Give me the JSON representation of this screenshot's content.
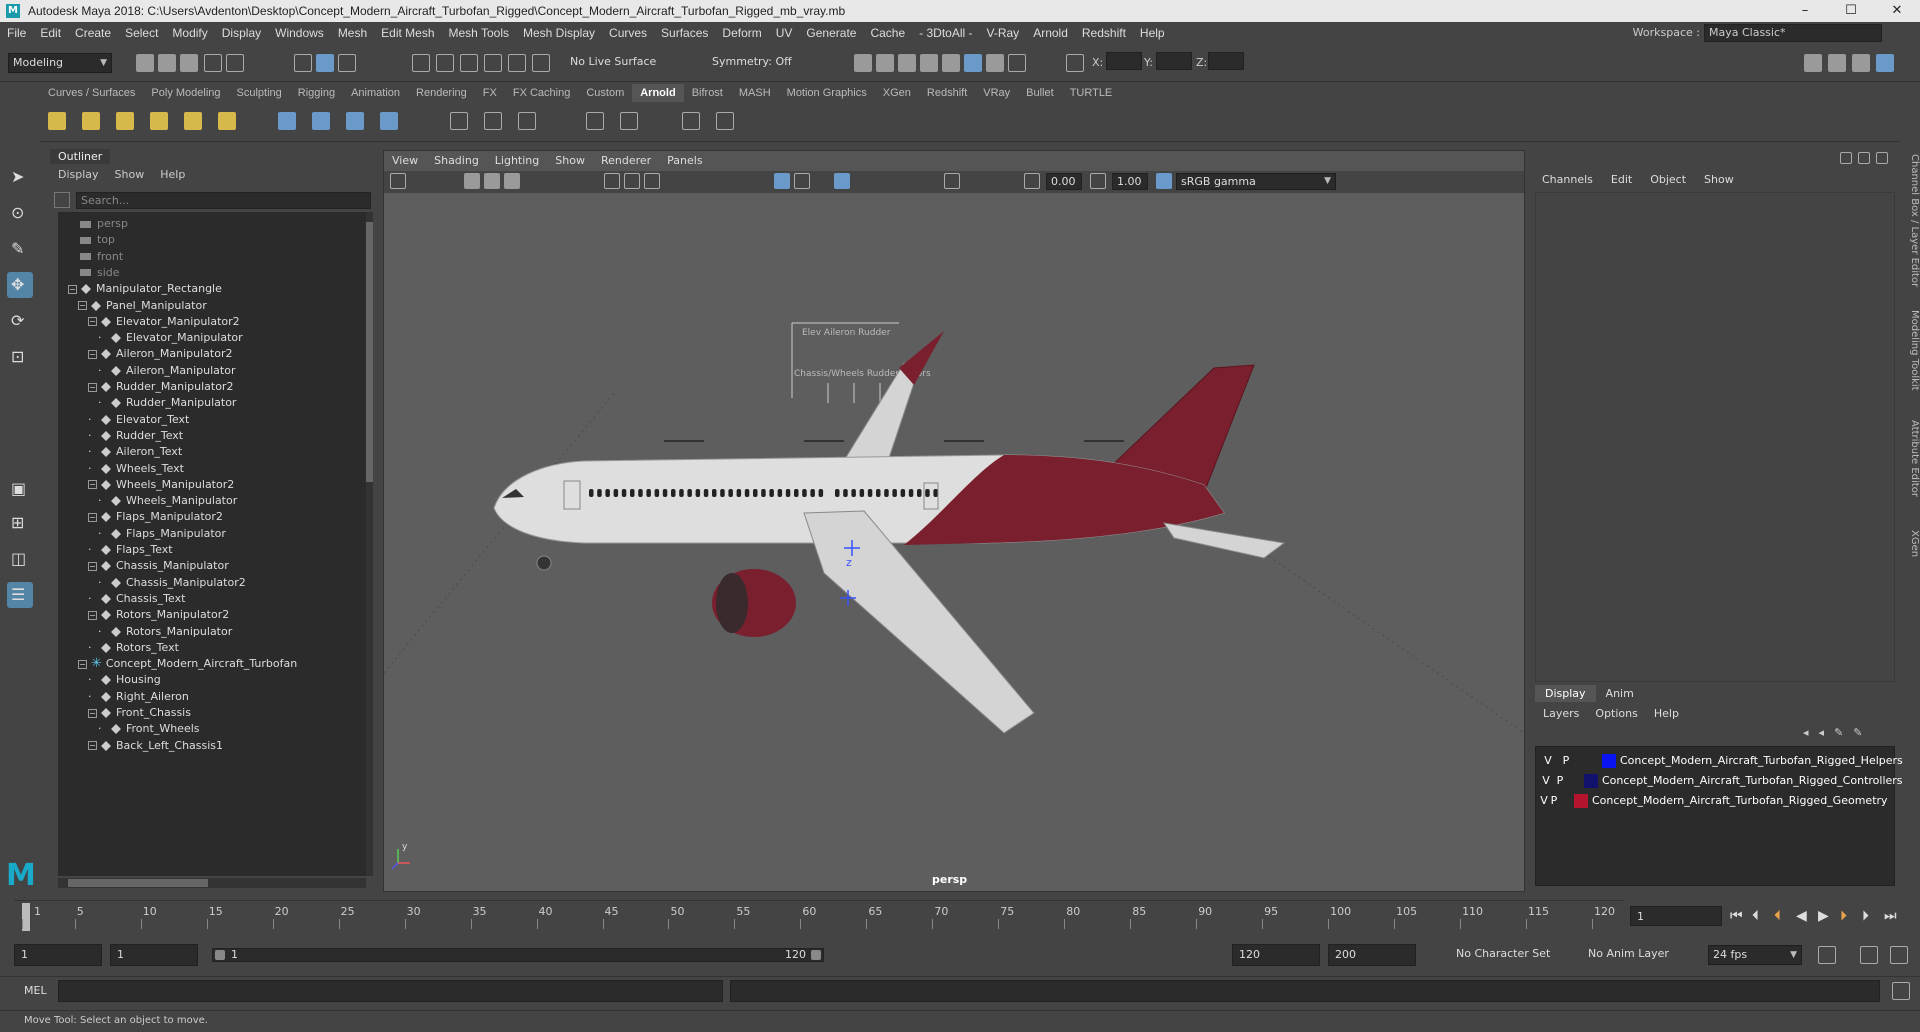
{
  "titlebar": {
    "title": "Autodesk Maya 2018: C:\\Users\\Avdenton\\Desktop\\Concept_Modern_Aircraft_Turbofan_Rigged\\Concept_Modern_Aircraft_Turbofan_Rigged_mb_vray.mb",
    "minimize": "–",
    "maximize": "☐",
    "close": "✕"
  },
  "menubar": {
    "items": [
      "File",
      "Edit",
      "Create",
      "Select",
      "Modify",
      "Display",
      "Windows",
      "Mesh",
      "Edit Mesh",
      "Mesh Tools",
      "Mesh Display",
      "Curves",
      "Surfaces",
      "Deform",
      "UV",
      "Generate",
      "Cache",
      "- 3DtoAll -",
      "V-Ray",
      "Arnold",
      "Redshift",
      "Help"
    ],
    "workspace_label": "Workspace :",
    "workspace_value": "Maya Classic*"
  },
  "statusline": {
    "mode": "Modeling",
    "live_surface": "No Live Surface",
    "symmetry": "Symmetry: Off",
    "x_label": "X:",
    "y_label": "Y:",
    "z_label": "Z:"
  },
  "shelf": {
    "tabs": [
      "Curves / Surfaces",
      "Poly Modeling",
      "Sculpting",
      "Rigging",
      "Animation",
      "Rendering",
      "FX",
      "FX Caching",
      "Custom",
      "Arnold",
      "Bifrost",
      "MASH",
      "Motion Graphics",
      "XGen",
      "Redshift",
      "VRay",
      "Bullet",
      "TURTLE"
    ],
    "active_tab": "Arnold"
  },
  "outliner": {
    "title": "Outliner",
    "menu": [
      "Display",
      "Show",
      "Help"
    ],
    "search_placeholder": "Search...",
    "nodes": [
      {
        "label": "persp",
        "indent": 0,
        "type": "camera"
      },
      {
        "label": "top",
        "indent": 0,
        "type": "camera"
      },
      {
        "label": "front",
        "indent": 0,
        "type": "camera"
      },
      {
        "label": "side",
        "indent": 0,
        "type": "camera"
      },
      {
        "label": "Manipulator_Rectangle",
        "indent": 0,
        "type": "group",
        "expanded": true
      },
      {
        "label": "Panel_Manipulator",
        "indent": 1,
        "type": "group",
        "expanded": true
      },
      {
        "label": "Elevator_Manipulator2",
        "indent": 2,
        "type": "group",
        "expanded": true
      },
      {
        "label": "Elevator_Manipulator",
        "indent": 3,
        "type": "node"
      },
      {
        "label": "Aileron_Manipulator2",
        "indent": 2,
        "type": "group",
        "expanded": true
      },
      {
        "label": "Aileron_Manipulator",
        "indent": 3,
        "type": "node"
      },
      {
        "label": "Rudder_Manipulator2",
        "indent": 2,
        "type": "group",
        "expanded": true
      },
      {
        "label": "Rudder_Manipulator",
        "indent": 3,
        "type": "node"
      },
      {
        "label": "Elevator_Text",
        "indent": 2,
        "type": "node"
      },
      {
        "label": "Rudder_Text",
        "indent": 2,
        "type": "node"
      },
      {
        "label": "Aileron_Text",
        "indent": 2,
        "type": "node"
      },
      {
        "label": "Wheels_Text",
        "indent": 2,
        "type": "node"
      },
      {
        "label": "Wheels_Manipulator2",
        "indent": 2,
        "type": "group",
        "expanded": true
      },
      {
        "label": "Wheels_Manipulator",
        "indent": 3,
        "type": "node"
      },
      {
        "label": "Flaps_Manipulator2",
        "indent": 2,
        "type": "group",
        "expanded": true
      },
      {
        "label": "Flaps_Manipulator",
        "indent": 3,
        "type": "node"
      },
      {
        "label": "Flaps_Text",
        "indent": 2,
        "type": "node"
      },
      {
        "label": "Chassis_Manipulator",
        "indent": 2,
        "type": "group",
        "expanded": true
      },
      {
        "label": "Chassis_Manipulator2",
        "indent": 3,
        "type": "node"
      },
      {
        "label": "Chassis_Text",
        "indent": 2,
        "type": "node"
      },
      {
        "label": "Rotors_Manipulator2",
        "indent": 2,
        "type": "group",
        "expanded": true
      },
      {
        "label": "Rotors_Manipulator",
        "indent": 3,
        "type": "node"
      },
      {
        "label": "Rotors_Text",
        "indent": 2,
        "type": "node"
      },
      {
        "label": "Concept_Modern_Aircraft_Turbofan",
        "indent": 1,
        "type": "joint",
        "expanded": true
      },
      {
        "label": "Housing",
        "indent": 2,
        "type": "node"
      },
      {
        "label": "Right_Aileron",
        "indent": 2,
        "type": "node"
      },
      {
        "label": "Front_Chassis",
        "indent": 2,
        "type": "group",
        "expanded": true
      },
      {
        "label": "Front_Wheels",
        "indent": 3,
        "type": "node"
      },
      {
        "label": "Back_Left_Chassis1",
        "indent": 2,
        "type": "group",
        "expanded": true
      }
    ]
  },
  "viewport": {
    "menu": [
      "View",
      "Shading",
      "Lighting",
      "Show",
      "Renderer",
      "Panels"
    ],
    "exposure": "0.00",
    "gamma": "1.00",
    "colorspace": "sRGB gamma",
    "camera_label": "persp",
    "overlay_text_1": "Elev   Aileron  Rudder",
    "overlay_text_2": "Chassis/Wheels   Rudder   Rotors",
    "axis_y": "y",
    "axis_z": "z"
  },
  "channelbox": {
    "menu": [
      "Channels",
      "Edit",
      "Object",
      "Show"
    ],
    "side_tabs": [
      "Channel Box / Layer Editor",
      "Modeling Toolkit",
      "Attribute Editor",
      "XGen"
    ]
  },
  "layers": {
    "tabs": [
      "Display",
      "Anim"
    ],
    "menu": [
      "Layers",
      "Options",
      "Help"
    ],
    "items": [
      {
        "v": "V",
        "p": "P",
        "name": "Concept_Modern_Aircraft_Turbofan_Rigged_Helpers",
        "color": "#0a14f0"
      },
      {
        "v": "V",
        "p": "P",
        "name": "Concept_Modern_Aircraft_Turbofan_Rigged_Controllers",
        "color": "#12126e"
      },
      {
        "v": "V",
        "p": "P",
        "name": "Concept_Modern_Aircraft_Turbofan_Rigged_Geometry",
        "color": "#b4142d"
      }
    ]
  },
  "timeline": {
    "ticks": [
      "1",
      "5",
      "10",
      "15",
      "20",
      "25",
      "30",
      "35",
      "40",
      "45",
      "50",
      "55",
      "60",
      "65",
      "70",
      "75",
      "80",
      "85",
      "90",
      "95",
      "100",
      "105",
      "110",
      "115",
      "120"
    ],
    "current_frame": "1"
  },
  "range": {
    "start": "1",
    "anim_start": "1",
    "slider_start": "1",
    "slider_end": "120",
    "end": "120",
    "anim_end": "200",
    "character_set": "No Character Set",
    "anim_layer": "No Anim Layer",
    "fps": "24 fps"
  },
  "mel": {
    "label": "MEL"
  },
  "helpline": {
    "text": "Move Tool: Select an object to move."
  },
  "colors": {
    "accent": "#5285a6",
    "maya_logo": "#19a9c9",
    "livery": "#7a1f2e"
  }
}
